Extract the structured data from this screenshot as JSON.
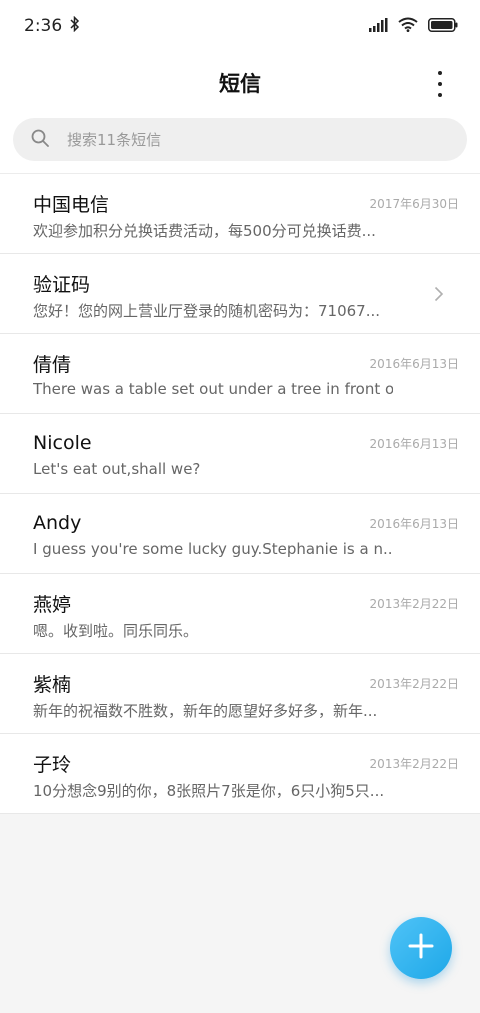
{
  "status": {
    "time": "2:36"
  },
  "header": {
    "title": "短信"
  },
  "search": {
    "placeholder": "搜索11条短信"
  },
  "messages": [
    {
      "name": "中国电信",
      "date": "2017年6月30日",
      "preview": "欢迎参加积分兑换话费活动，每500分可兑换话费..."
    },
    {
      "name": "验证码",
      "date": "",
      "preview": "您好！您的网上营业厅登录的随机密码为：71067..."
    },
    {
      "name": "倩倩",
      "date": "2016年6月13日",
      "preview": "There was a table set out under a tree in front o..."
    },
    {
      "name": "Nicole",
      "date": "2016年6月13日",
      "preview": "Let's eat out,shall we?"
    },
    {
      "name": "Andy",
      "date": "2016年6月13日",
      "preview": "I guess you're some lucky guy.Stephanie is a n..."
    },
    {
      "name": "燕婷",
      "date": "2013年2月22日",
      "preview": "嗯。收到啦。同乐同乐。"
    },
    {
      "name": "紫楠",
      "date": "2013年2月22日",
      "preview": "新年的祝福数不胜数，新年的愿望好多好多，新年..."
    },
    {
      "name": "子玲",
      "date": "2013年2月22日",
      "preview": "10分想念9别的你，8张照片7张是你，6只小狗5只..."
    }
  ],
  "colors": {
    "accent": "#1ea8e8"
  }
}
